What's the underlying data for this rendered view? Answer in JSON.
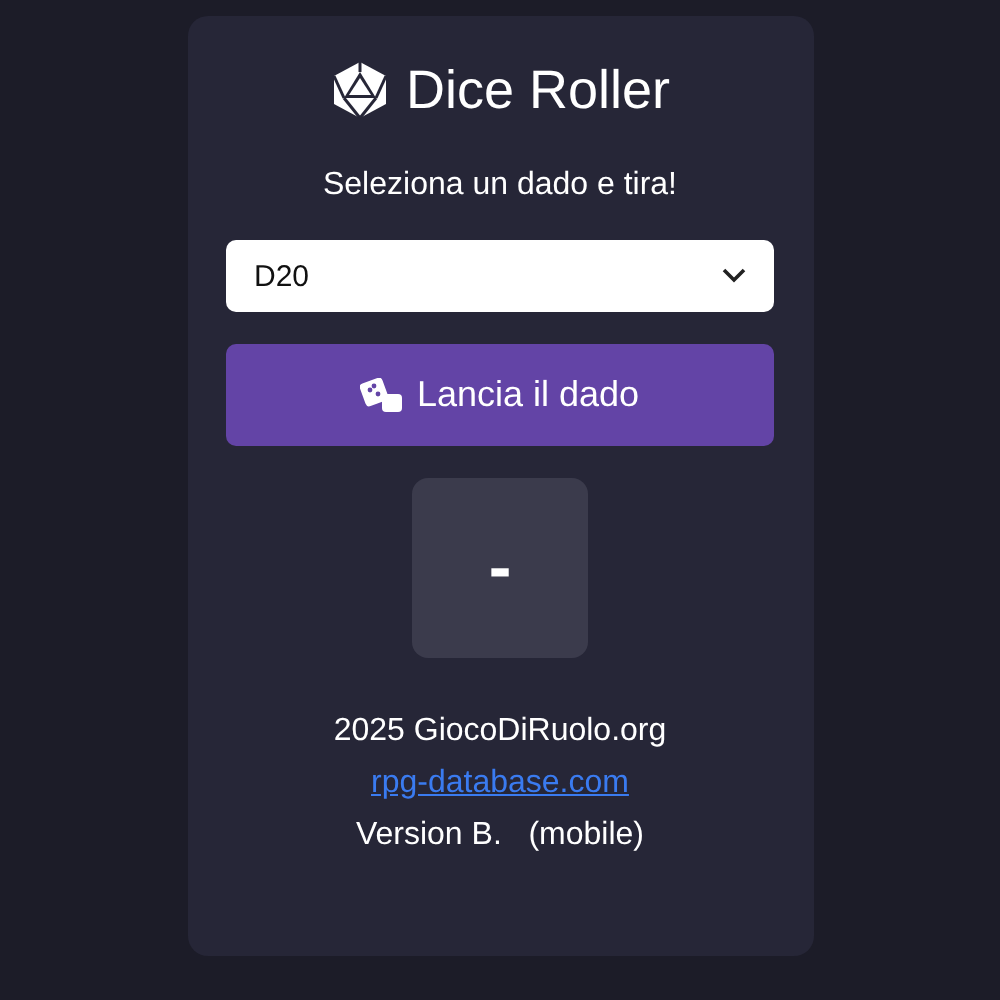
{
  "title": "Dice Roller",
  "prompt": "Seleziona un dado e tira!",
  "dice_select": {
    "value": "D20"
  },
  "roll_button": {
    "label": "Lancia il dado"
  },
  "result": "-",
  "footer": {
    "copyright": "2025 GiocoDiRuolo.org",
    "link": "rpg-database.com",
    "version": "Version B.   (mobile)"
  }
}
